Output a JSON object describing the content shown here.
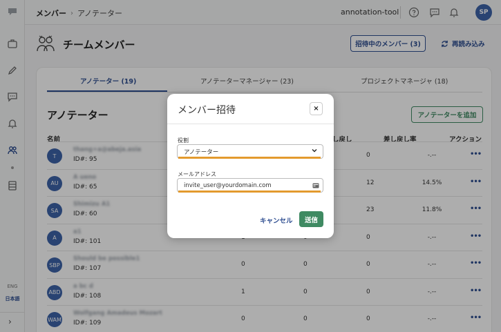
{
  "breadcrumb": {
    "parent": "メンバー",
    "current": "アノテーター"
  },
  "header": {
    "project_name": "annotation-tool",
    "user_initials": "SP"
  },
  "page": {
    "title": "チームメンバー",
    "invited_button": "招待中のメンバー (3)",
    "reload_button": "再読み込み"
  },
  "tabs": [
    {
      "label": "アノテーター (19)",
      "active": true
    },
    {
      "label": "アノテーターマネージャー (23)",
      "active": false
    },
    {
      "label": "プロジェクトマネージャ (18)",
      "active": false
    }
  ],
  "section": {
    "title": "アノテーター",
    "add_button": "アノテーターを追加"
  },
  "table": {
    "headers": {
      "name": "名前",
      "returns": "し戻し",
      "return_rate": "差し戻し率",
      "action": "アクション"
    },
    "rows": [
      {
        "initials": "T",
        "name": "thang+a@abeja.asia",
        "id": "ID#: 95",
        "c1": "",
        "c2": "",
        "c3": "0",
        "rate": "-.--"
      },
      {
        "initials": "AU",
        "name": "A ueno",
        "id": "ID#: 65",
        "c1": "",
        "c2": "",
        "c3": "12",
        "rate": "14.5%"
      },
      {
        "initials": "SA",
        "name": "Shimizu A1",
        "id": "ID#: 60",
        "c1": "",
        "c2": "",
        "c3": "23",
        "rate": "11.8%"
      },
      {
        "initials": "A",
        "name": "a1",
        "id": "ID#: 101",
        "c1": "1",
        "c2": "0",
        "c3": "0",
        "rate": "-.--"
      },
      {
        "initials": "SBP",
        "name": "Should be possible1",
        "id": "ID#: 107",
        "c1": "0",
        "c2": "0",
        "c3": "0",
        "rate": "-.--"
      },
      {
        "initials": "ABD",
        "name": "a bc d",
        "id": "ID#: 108",
        "c1": "1",
        "c2": "0",
        "c3": "0",
        "rate": "-.--"
      },
      {
        "initials": "WAM",
        "name": "Wolfgang Amadeus Mozart",
        "id": "ID#: 109",
        "c1": "0",
        "c2": "0",
        "c3": "0",
        "rate": "-.--"
      }
    ],
    "action_glyph": "•••"
  },
  "sidebar": {
    "lang_en": "ENG",
    "lang_sep": "·",
    "lang_ja": "日本語",
    "expand_glyph": "›"
  },
  "modal": {
    "title": "メンバー招待",
    "close_glyph": "×",
    "role_label": "役割",
    "role_value": "アノテーター",
    "email_label": "メールアドレス",
    "email_value": "invite_user@yourdomain.com",
    "cancel_button": "キャンセル",
    "submit_button": "送信"
  },
  "colors": {
    "primary": "#2f4e91",
    "success": "#3f8a62",
    "highlight": "#e39a2e",
    "avatar": "#3d63a8"
  }
}
